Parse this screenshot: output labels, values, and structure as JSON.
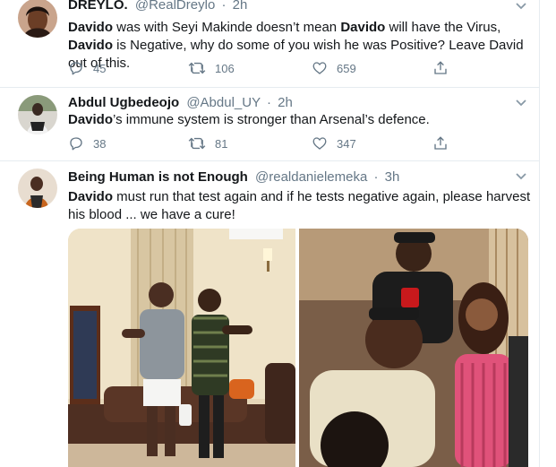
{
  "tweets": [
    {
      "name": "DREYLO.",
      "handle": "@RealDreylo",
      "dot": "·",
      "time": "2h",
      "text": [
        {
          "b": "Davido"
        },
        {
          "t": " was with Seyi Makinde doesn’t mean "
        },
        {
          "b": "Davido"
        },
        {
          "t": " will have the Virus, "
        },
        {
          "b": "Davido"
        },
        {
          "t": " is Negative, why do some of you wish he was Positive? Leave David out of this."
        }
      ],
      "replies": "45",
      "retweets": "106",
      "likes": "659"
    },
    {
      "name": "Abdul Ugbedeojo",
      "handle": "@Abdul_UY",
      "dot": "·",
      "time": "2h",
      "text": [
        {
          "b": "Davido"
        },
        {
          "t": "’s immune system is stronger than Arsenal’s defence."
        }
      ],
      "replies": "38",
      "retweets": "81",
      "likes": "347"
    },
    {
      "name": "Being Human is not Enough",
      "handle": "@realdanielemeka",
      "dot": "·",
      "time": "3h",
      "text": [
        {
          "b": "Davido"
        },
        {
          "t": " must run that test again and if he tests negative again, please harvest his blood ... we have a cure!"
        }
      ]
    }
  ],
  "colors": {
    "text": "#14171a",
    "muted": "#657786",
    "divider": "#e6ecf0",
    "chevron": "#8899a6"
  },
  "icons": {
    "reply": "reply-icon",
    "retweet": "retweet-icon",
    "like": "like-icon",
    "share": "share-icon",
    "more": "chevron-down-icon"
  }
}
